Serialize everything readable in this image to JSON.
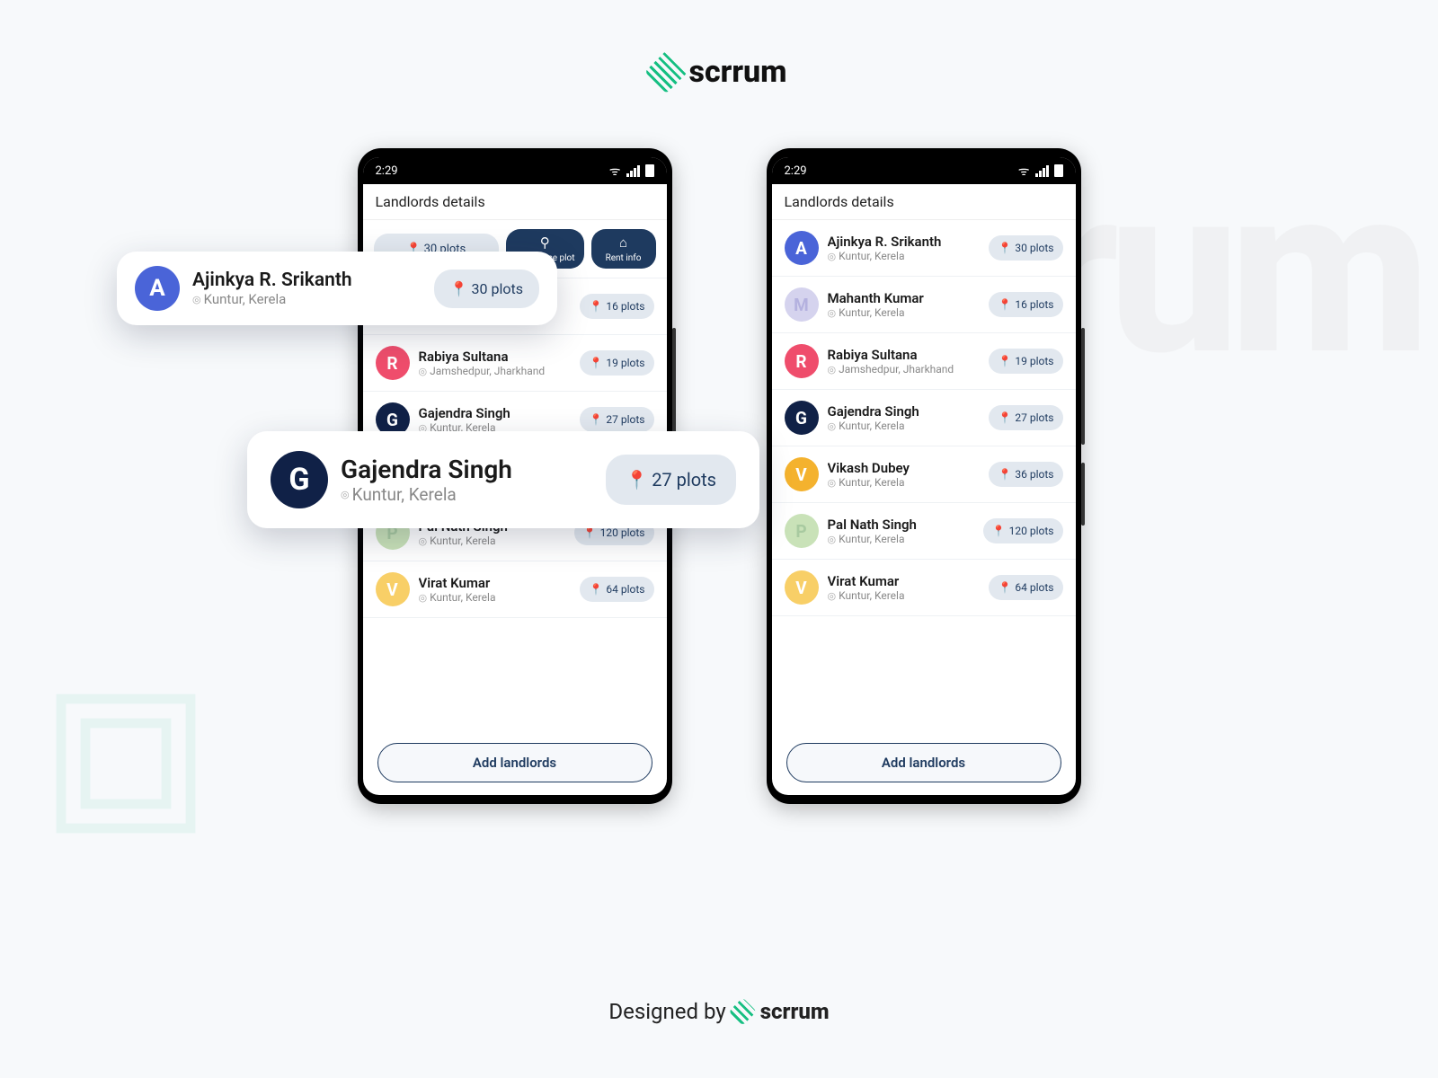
{
  "brand": "scrrum",
  "footer_prefix": "Designed by",
  "statusbar": {
    "time": "2:29"
  },
  "page_title": "Landlords details",
  "add_button": "Add landlords",
  "action_row": {
    "plots": "📍 30 plots",
    "geo": "Geo Fence plot",
    "rent": "Rent info"
  },
  "landlords": [
    {
      "initial": "A",
      "avclass": "av-A",
      "name": "Ajinkya R. Srikanth",
      "loc": "Kuntur, Kerela",
      "plots": "30 plots"
    },
    {
      "initial": "M",
      "avclass": "av-M",
      "name": "Mahanth Kumar",
      "loc": "Kuntur, Kerela",
      "plots": "16 plots"
    },
    {
      "initial": "R",
      "avclass": "av-R",
      "name": "Rabiya Sultana",
      "loc": "Jamshedpur, Jharkhand",
      "plots": "19 plots"
    },
    {
      "initial": "G",
      "avclass": "av-G",
      "name": "Gajendra Singh",
      "loc": "Kuntur, Kerela",
      "plots": "27 plots"
    },
    {
      "initial": "V",
      "avclass": "av-V",
      "name": "Vikash Dubey",
      "loc": "Kuntur, Kerela",
      "plots": "36 plots"
    },
    {
      "initial": "P",
      "avclass": "av-P",
      "name": "Pal Nath Singh",
      "loc": "Kuntur, Kerela",
      "plots": "120 plots"
    },
    {
      "initial": "V",
      "avclass": "av-V2",
      "name": "Virat Kumar",
      "loc": "Kuntur, Kerela",
      "plots": "64 plots"
    }
  ],
  "float1": {
    "initial": "A",
    "name": "Ajinkya R. Srikanth",
    "loc": "Kuntur, Kerela",
    "plots": "30 plots"
  },
  "float2": {
    "initial": "G",
    "name": "Gajendra Singh",
    "loc": "Kuntur, Kerela",
    "plots": "27 plots"
  }
}
